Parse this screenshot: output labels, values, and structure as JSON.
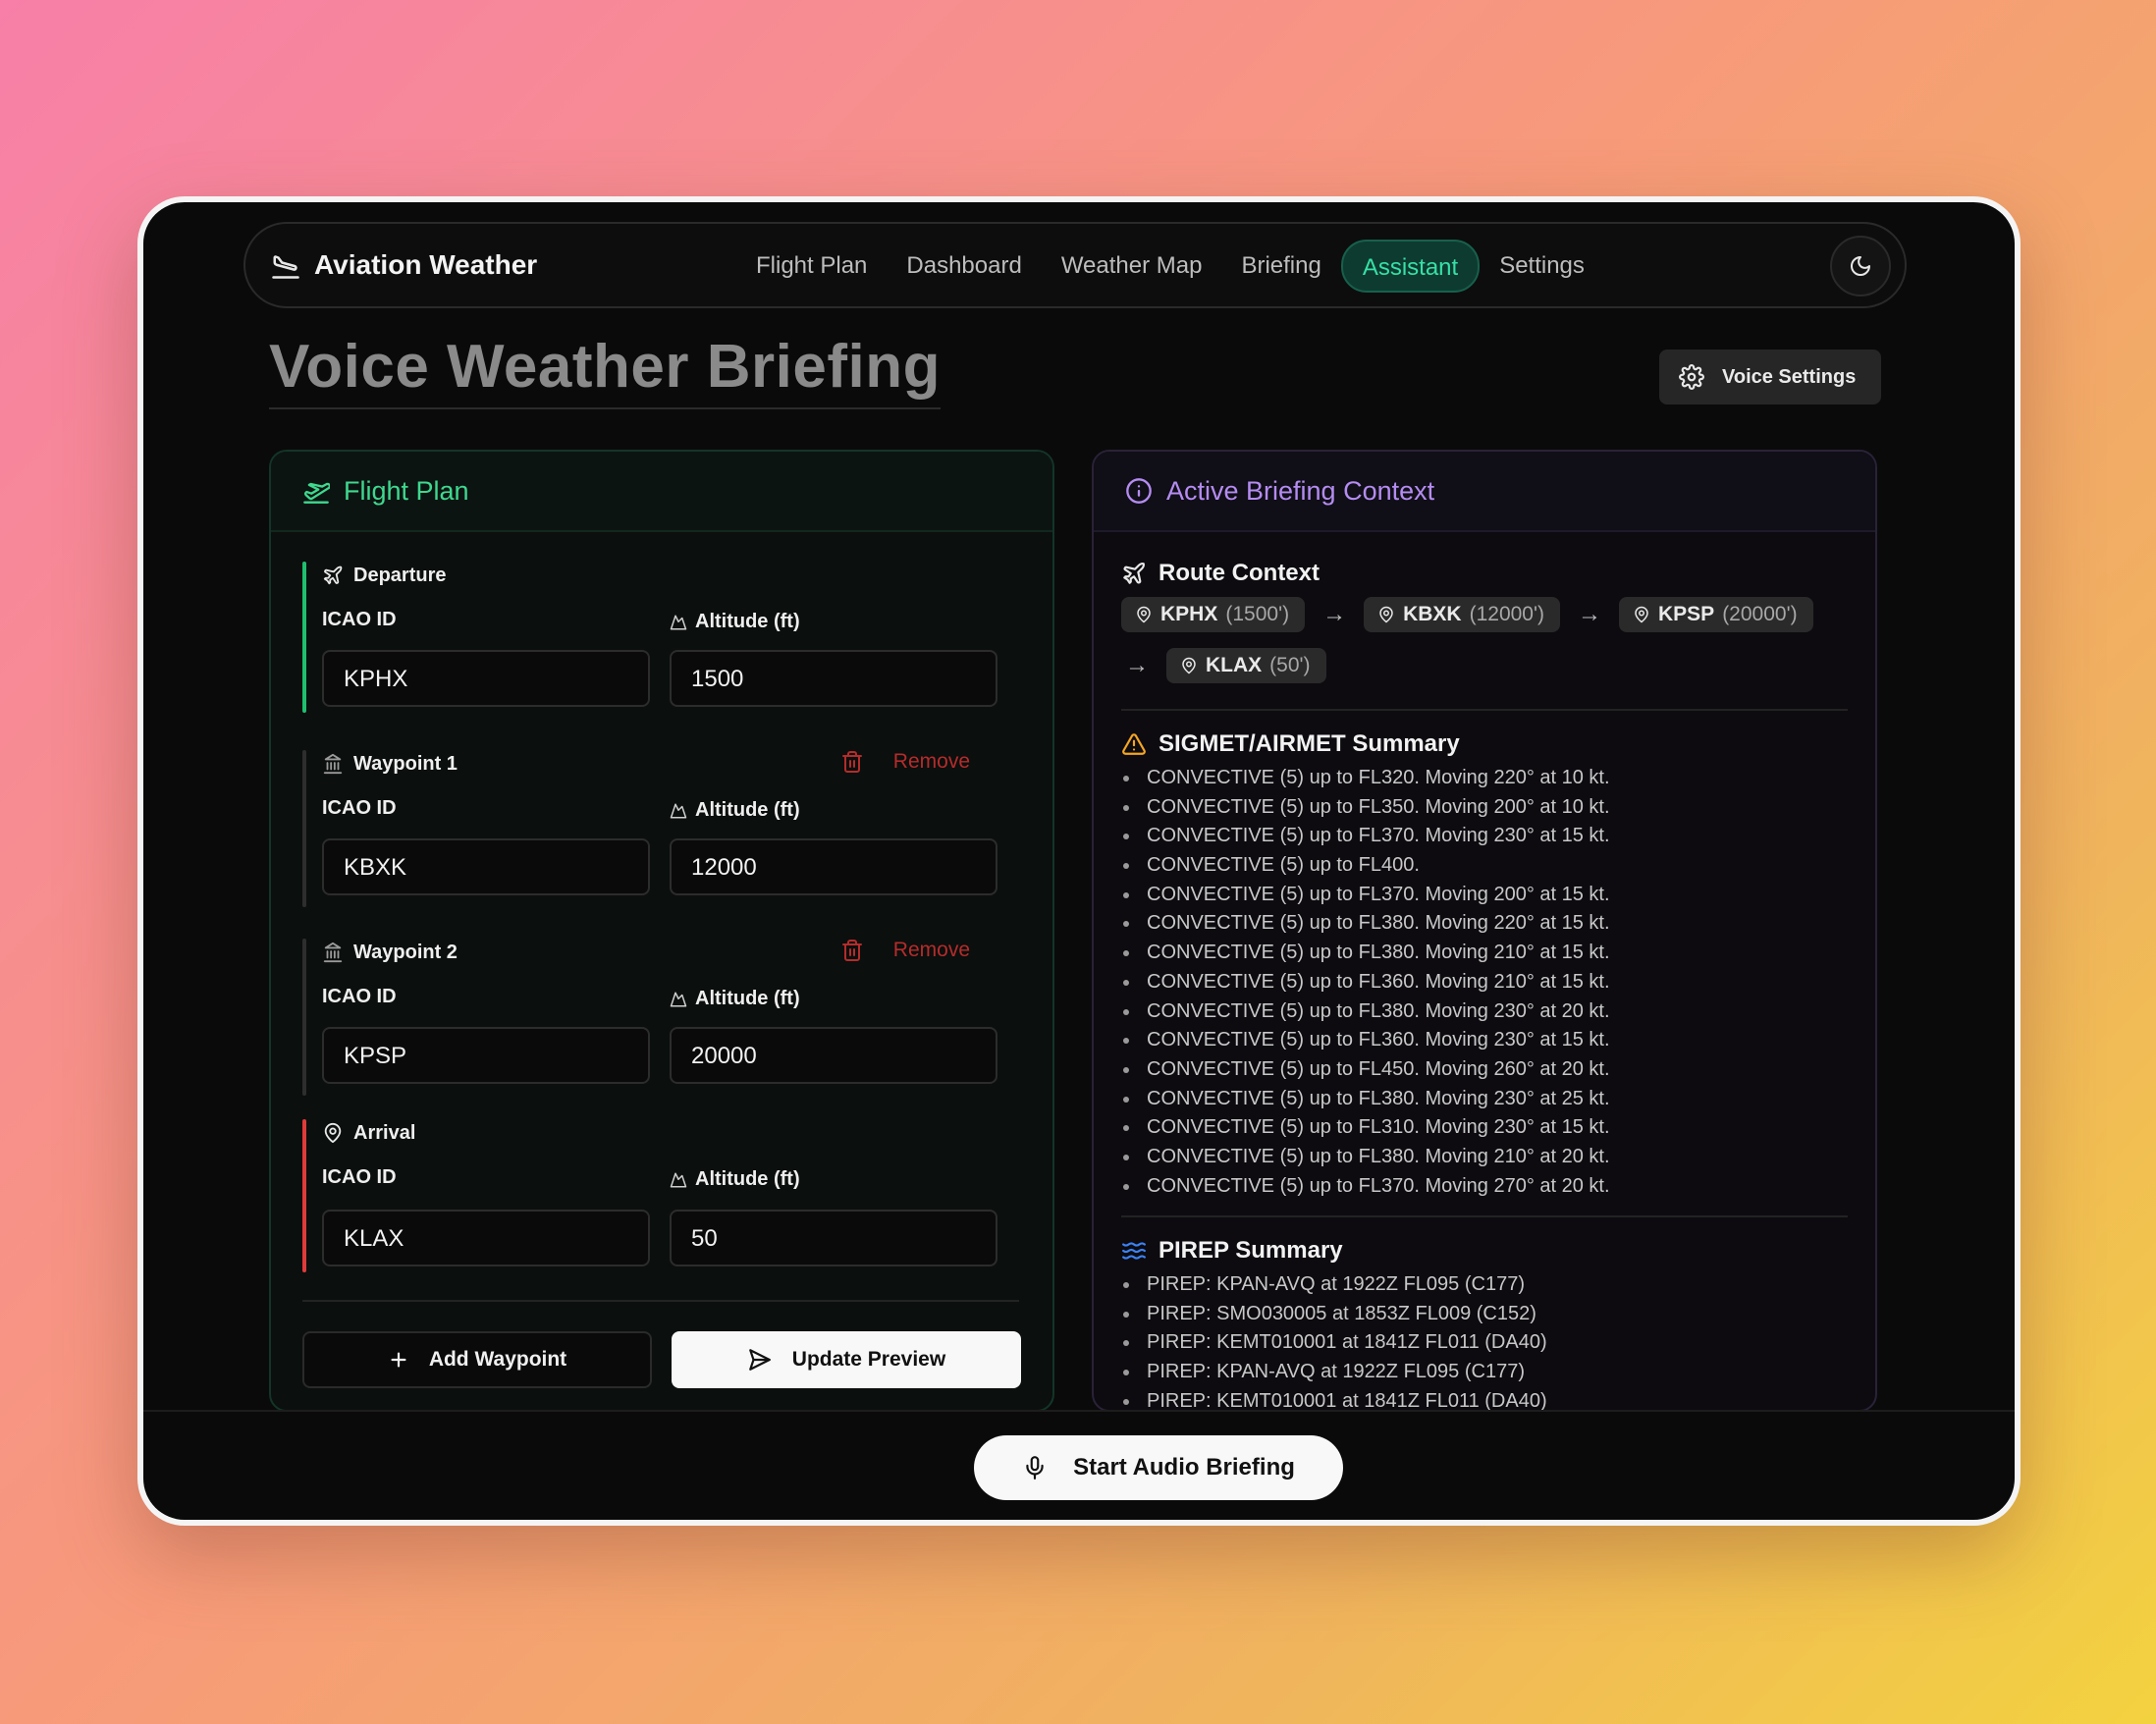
{
  "app": {
    "name": "Aviation Weather"
  },
  "nav": {
    "links": [
      "Flight Plan",
      "Dashboard",
      "Weather Map",
      "Briefing",
      "Assistant",
      "Settings"
    ],
    "active": "Assistant"
  },
  "page": {
    "title": "Voice Weather Briefing",
    "voice_settings_label": "Voice Settings"
  },
  "flight_plan": {
    "title": "Flight Plan",
    "icao_label": "ICAO ID",
    "altitude_label": "Altitude (ft)",
    "remove_label": "Remove",
    "departure": {
      "title": "Departure",
      "icao": "KPHX",
      "altitude": "1500"
    },
    "waypoints": [
      {
        "title": "Waypoint 1",
        "icao": "KBXK",
        "altitude": "12000"
      },
      {
        "title": "Waypoint 2",
        "icao": "KPSP",
        "altitude": "20000"
      }
    ],
    "arrival": {
      "title": "Arrival",
      "icao": "KLAX",
      "altitude": "50"
    },
    "add_waypoint_label": "Add Waypoint",
    "update_preview_label": "Update Preview"
  },
  "context": {
    "title": "Active Briefing Context",
    "route_title": "Route Context",
    "route": [
      {
        "id": "KPHX",
        "alt": "(1500')"
      },
      {
        "id": "KBXK",
        "alt": "(12000')"
      },
      {
        "id": "KPSP",
        "alt": "(20000')"
      },
      {
        "id": "KLAX",
        "alt": "(50')"
      }
    ],
    "sigmet_title": "SIGMET/AIRMET Summary",
    "sigmets": [
      "CONVECTIVE (5) up to FL320. Moving 220° at 10 kt.",
      "CONVECTIVE (5) up to FL350. Moving 200° at 10 kt.",
      "CONVECTIVE (5) up to FL370. Moving 230° at 15 kt.",
      "CONVECTIVE (5) up to FL400.",
      "CONVECTIVE (5) up to FL370. Moving 200° at 15 kt.",
      "CONVECTIVE (5) up to FL380. Moving 220° at 15 kt.",
      "CONVECTIVE (5) up to FL380. Moving 210° at 15 kt.",
      "CONVECTIVE (5) up to FL360. Moving 210° at 15 kt.",
      "CONVECTIVE (5) up to FL380. Moving 230° at 20 kt.",
      "CONVECTIVE (5) up to FL360. Moving 230° at 15 kt.",
      "CONVECTIVE (5) up to FL450. Moving 260° at 20 kt.",
      "CONVECTIVE (5) up to FL380. Moving 230° at 25 kt.",
      "CONVECTIVE (5) up to FL310. Moving 230° at 15 kt.",
      "CONVECTIVE (5) up to FL380. Moving 210° at 20 kt.",
      "CONVECTIVE (5) up to FL370. Moving 270° at 20 kt."
    ],
    "pirep_title": "PIREP Summary",
    "pireps": [
      "PIREP: KPAN-AVQ at 1922Z FL095 (C177)",
      "PIREP: SMO030005 at 1853Z FL009 (C152)",
      "PIREP: KEMT010001 at 1841Z FL011 (DA40)",
      "PIREP: KPAN-AVQ at 1922Z FL095 (C177)",
      "PIREP: KEMT010001 at 1841Z FL011 (DA40)"
    ]
  },
  "footer": {
    "start_label": "Start Audio Briefing"
  },
  "colors": {
    "accent_green": "#3fd88f",
    "accent_purple": "#b48cf2",
    "danger": "#b42c2c",
    "warning": "#f5a524",
    "pirep_blue": "#3b82f6"
  }
}
